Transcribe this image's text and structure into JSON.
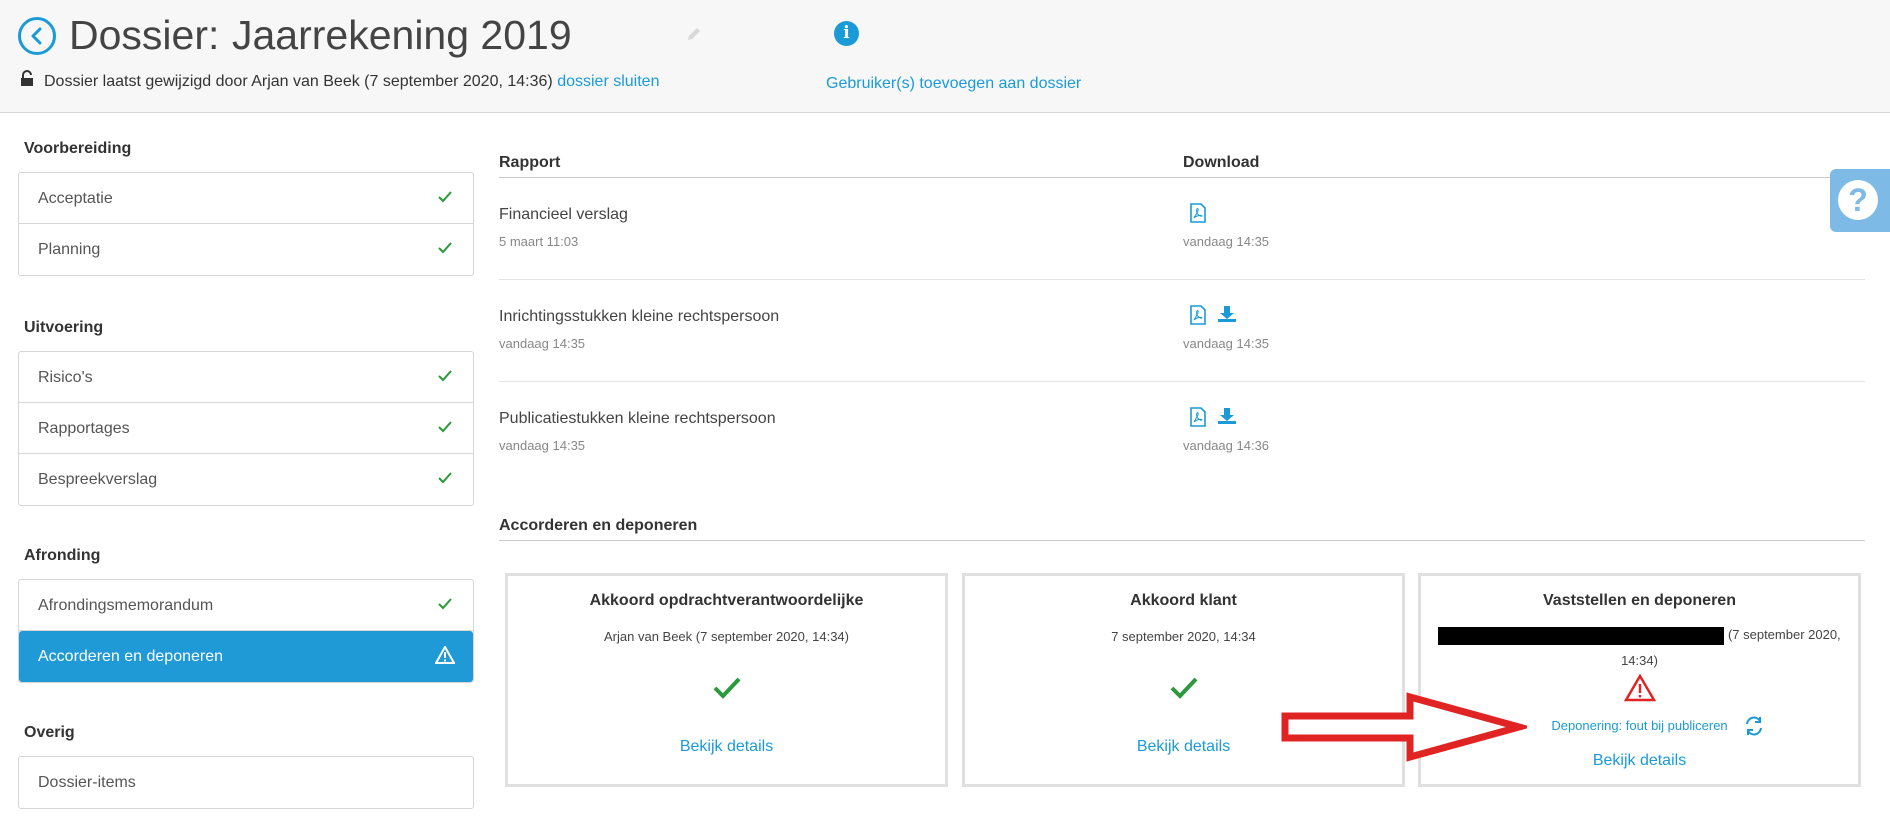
{
  "header": {
    "title_prefix": "Dossier:",
    "title_name": "Jaarrekening 2019",
    "modified_text": "Dossier laatst gewijzigd door Arjan van Beek (7 september 2020, 14:36)",
    "close_link": "dossier sluiten",
    "add_users_link": "Gebruiker(s) toevoegen aan dossier",
    "info_glyph": "i"
  },
  "sidebar": {
    "sections": [
      {
        "title": "Voorbereiding",
        "items": [
          {
            "label": "Acceptatie",
            "icon": "check-icon"
          },
          {
            "label": "Planning",
            "icon": "check-icon"
          }
        ]
      },
      {
        "title": "Uitvoering",
        "items": [
          {
            "label": "Risico's",
            "icon": "check-icon"
          },
          {
            "label": "Rapportages",
            "icon": "check-icon"
          },
          {
            "label": "Bespreekverslag",
            "icon": "check-icon"
          }
        ]
      },
      {
        "title": "Afronding",
        "items": [
          {
            "label": "Afrondingsmemorandum",
            "icon": "check-icon"
          },
          {
            "label": "Accorderen en deponeren",
            "icon": "warning-icon",
            "active": true
          }
        ]
      },
      {
        "title": "Overig",
        "items": [
          {
            "label": "Dossier-items"
          }
        ]
      }
    ]
  },
  "reports": {
    "col_report": "Rapport",
    "col_download": "Download",
    "rows": [
      {
        "name": "Financieel verslag",
        "date": "5 maart 11:03",
        "download_date": "vandaag 14:35",
        "icons": [
          "pdf-icon"
        ]
      },
      {
        "name": "Inrichtingsstukken kleine rechtspersoon",
        "date": "vandaag 14:35",
        "download_date": "vandaag 14:35",
        "icons": [
          "pdf-icon",
          "download-icon"
        ]
      },
      {
        "name": "Publicatiestukken kleine rechtspersoon",
        "date": "vandaag 14:35",
        "download_date": "vandaag 14:36",
        "icons": [
          "pdf-icon",
          "download-icon"
        ]
      }
    ]
  },
  "approval": {
    "title": "Accorderen en deponeren",
    "cards": [
      {
        "title": "Akkoord opdrachtverantwoordelijke",
        "subtitle": "Arjan van Beek (7 september 2020, 14:34)",
        "link": "Bekijk details"
      },
      {
        "title": "Akkoord klant",
        "subtitle": "7 september 2020, 14:34",
        "link": "Bekijk details"
      },
      {
        "title": "Vaststellen en deponeren",
        "subtitle": "(7 september 2020, 14:34)",
        "status": "Deponering: fout bij publiceren",
        "link": "Bekijk details"
      }
    ]
  },
  "help": {
    "glyph": "?"
  },
  "colors": {
    "accent": "#1a9bd7",
    "active_bg": "#1f9ad6",
    "check": "#2a9a3a",
    "error": "#e02424"
  }
}
